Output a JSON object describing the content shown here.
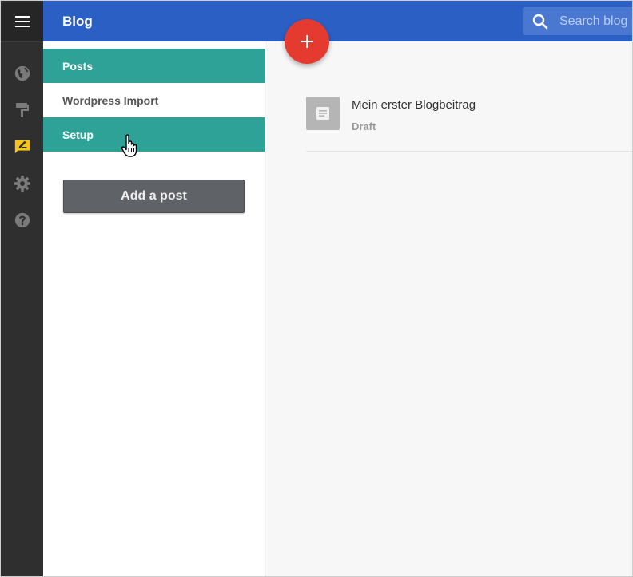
{
  "header": {
    "title": "Blog"
  },
  "search": {
    "placeholder": "Search blog posts"
  },
  "rail": {
    "items": [
      {
        "icon": "globe-icon"
      },
      {
        "icon": "paint-roller-icon"
      },
      {
        "icon": "blog-edit-icon",
        "active": true,
        "color": "#f5c518"
      },
      {
        "icon": "gear-icon"
      },
      {
        "icon": "help-icon"
      }
    ]
  },
  "sidebar": {
    "items": [
      {
        "label": "Posts",
        "state": "active"
      },
      {
        "label": "Wordpress Import",
        "state": "normal"
      },
      {
        "label": "Setup",
        "state": "hover"
      }
    ],
    "add_button_label": "Add a post"
  },
  "posts": [
    {
      "title": "Mein erster Blogbeitrag",
      "status": "Draft"
    }
  ],
  "colors": {
    "header_blue": "#2c5fc3",
    "teal_active": "#2ea296",
    "fab_red": "#e53a2f",
    "rail_dark": "#2f2f2f"
  }
}
